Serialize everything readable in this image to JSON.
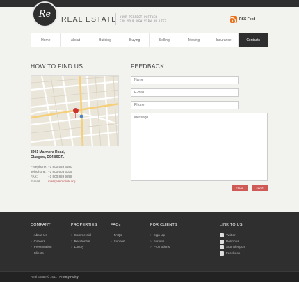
{
  "header": {
    "logo_text": "Re",
    "brand": "REAL ESTATE",
    "tagline_line1": "YOUR PERFECT PARTNER",
    "tagline_line2": "FOR YOUR NEW VIEW ON LIFE",
    "rss_label": "RSS Feed"
  },
  "nav": {
    "items": [
      {
        "label": "Home"
      },
      {
        "label": "About"
      },
      {
        "label": "Building"
      },
      {
        "label": "Buying"
      },
      {
        "label": "Selling"
      },
      {
        "label": "Moving"
      },
      {
        "label": "Insurance"
      },
      {
        "label": "Contacts"
      }
    ],
    "active_index": 7
  },
  "find_us": {
    "heading": "HOW TO FIND US",
    "address_line1": "8901 Marmora Road,",
    "address_line2": "Glasgow, D04 89GR.",
    "contacts": [
      {
        "label": "Freephone:",
        "value": "+1 800 559 6580"
      },
      {
        "label": "Telephone:",
        "value": "+1 800 603 6035"
      },
      {
        "label": "FAX:",
        "value": "+1 800 889 9898"
      },
      {
        "label": "E-mail:",
        "value": "mail@demolink.org"
      }
    ]
  },
  "feedback": {
    "heading": "FEEDBACK",
    "name_placeholder": "Name",
    "email_placeholder": "E-mail",
    "phone_placeholder": "Phone",
    "message_placeholder": "Message",
    "clear_label": "clear",
    "send_label": "send"
  },
  "footer": {
    "columns": [
      {
        "heading": "COMPANY",
        "items": [
          "About Us",
          "Careers",
          "Presentation",
          "Clients"
        ]
      },
      {
        "heading": "PROPERTIES",
        "items": [
          "Commercial",
          "Residential",
          "Luxury"
        ]
      },
      {
        "heading": "FAQs",
        "items": [
          "FAQs",
          "Support"
        ]
      },
      {
        "heading": "FOR CLIENTS",
        "items": [
          "Sign Up",
          "Forums",
          "Promotions"
        ]
      }
    ],
    "social": {
      "heading": "LINK TO US",
      "items": [
        {
          "label": "Twitter",
          "icon": "twitter-icon"
        },
        {
          "label": "Delicious",
          "icon": "delicious-icon"
        },
        {
          "label": "Stumbleupon",
          "icon": "stumbleupon-icon"
        },
        {
          "label": "Facebook",
          "icon": "facebook-icon"
        }
      ]
    },
    "copyright": "Real Estate © 2011",
    "privacy": "Privacy Policy"
  },
  "colors": {
    "accent": "#cf5a55",
    "dark": "#2e2e2e",
    "rss": "#e8741f"
  }
}
